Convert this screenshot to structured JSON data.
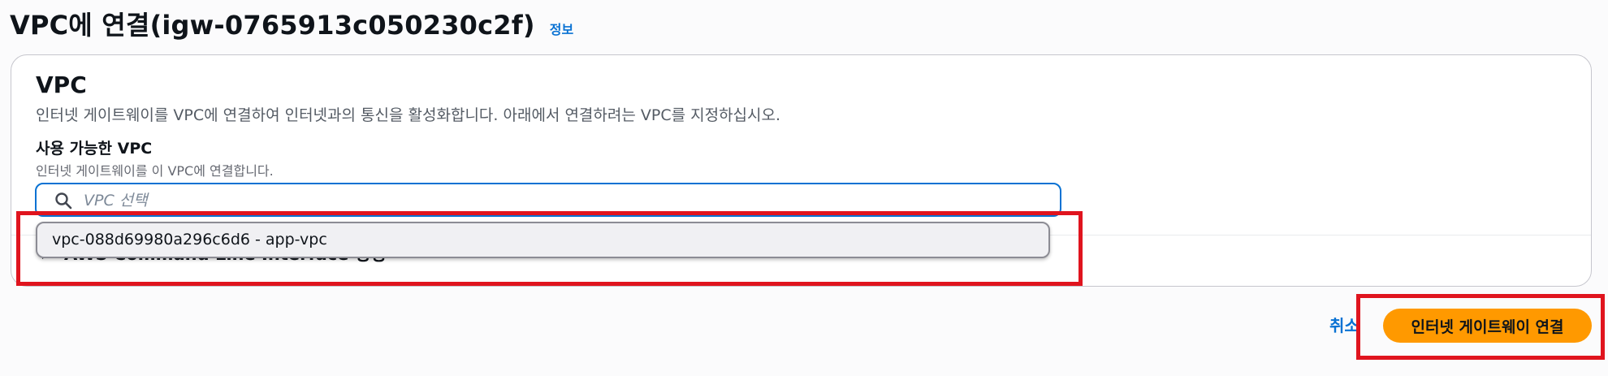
{
  "header": {
    "title": "VPC에 연결(igw-0765913c050230c2f)",
    "info_link": "정보"
  },
  "panel": {
    "title": "VPC",
    "description": "인터넷 게이트웨이를 VPC에 연결하여 인터넷과의 통신을 활성화합니다. 아래에서 연결하려는 VPC를 지정하십시오.",
    "field_label": "사용 가능한 VPC",
    "field_description": "인터넷 게이트웨이를 이 VPC에 연결합니다.",
    "search_placeholder": "VPC 선택",
    "search_value": "",
    "cli_section": "AWS Command Line Interface 명령"
  },
  "dropdown": {
    "options": [
      "vpc-088d69980a296c6d6 - app-vpc"
    ]
  },
  "footer": {
    "cancel_label": "취소",
    "attach_label": "인터넷 게이트웨이 연결"
  },
  "colors": {
    "accent": "#0972d3",
    "primary_button": "#ff9900",
    "highlight": "#e0141e"
  }
}
